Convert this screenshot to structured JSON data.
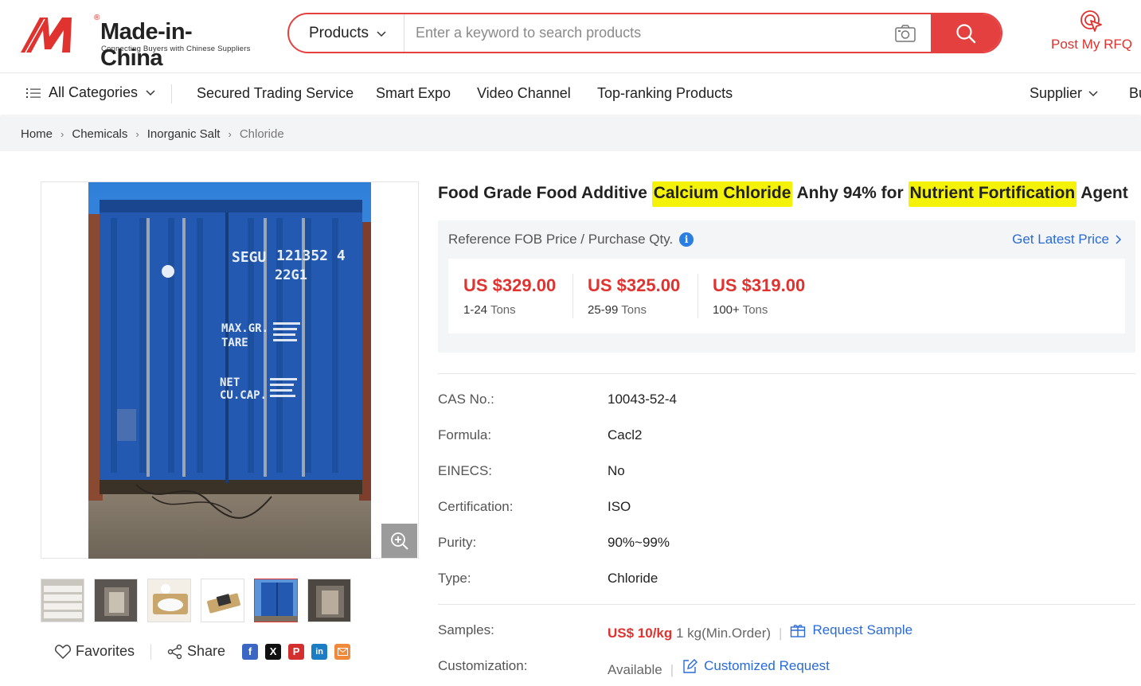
{
  "header": {
    "logo_name": "Made-in-China",
    "logo_tagline": "Connecting Buyers with Chinese Suppliers",
    "logo_mark": "®",
    "search_category": "Products",
    "search_placeholder": "Enter a keyword to search products",
    "rfq_label": "Post My RFQ",
    "brand_color": "#e0322e"
  },
  "nav": {
    "all_categories": "All Categories",
    "items": [
      "Secured Trading Service",
      "Smart Expo",
      "Video Channel",
      "Top-ranking Products"
    ],
    "supplier": "Supplier",
    "truncated": "Bu"
  },
  "breadcrumb": [
    "Home",
    "Chemicals",
    "Inorganic Salt",
    "Chloride"
  ],
  "product": {
    "title_parts": [
      "Food Grade Food Additive ",
      "Calcium Chloride",
      " Anhy 94% for ",
      "Nutrient Fortification",
      " Agent"
    ],
    "reference_label": "Reference FOB Price / Purchase Qty.",
    "latest_price": "Get Latest Price",
    "tiers": [
      {
        "price": "US $329.00",
        "qty": "1-24",
        "unit": "Tons"
      },
      {
        "price": "US $325.00",
        "qty": "25-99",
        "unit": "Tons"
      },
      {
        "price": "US $319.00",
        "qty": "100+",
        "unit": "Tons"
      }
    ],
    "specs": [
      {
        "key": "CAS No.:",
        "value": "10043-52-4"
      },
      {
        "key": "Formula:",
        "value": "Cacl2"
      },
      {
        "key": "EINECS:",
        "value": "No"
      },
      {
        "key": "Certification:",
        "value": "ISO"
      },
      {
        "key": "Purity:",
        "value": "90%~99%"
      },
      {
        "key": "Type:",
        "value": "Chloride"
      }
    ],
    "samples": {
      "key": "Samples:",
      "price": "US$ 10/kg",
      "min_order": "1 kg(Min.Order)",
      "action": "Request Sample"
    },
    "customization": {
      "key": "Customization:",
      "value": "Available",
      "action": "Customized Request"
    }
  },
  "gallery": {
    "container_text": [
      "SEGU",
      "121352 4",
      "22G1",
      "MAX.GR.",
      "TARE",
      "NET",
      "CU.CAP."
    ],
    "active_thumb_index": 4,
    "thumb_count": 6
  },
  "social": {
    "favorites": "Favorites",
    "share": "Share",
    "icons": [
      "facebook-icon",
      "x-icon",
      "pinterest-icon",
      "linkedin-icon",
      "email-icon"
    ]
  }
}
